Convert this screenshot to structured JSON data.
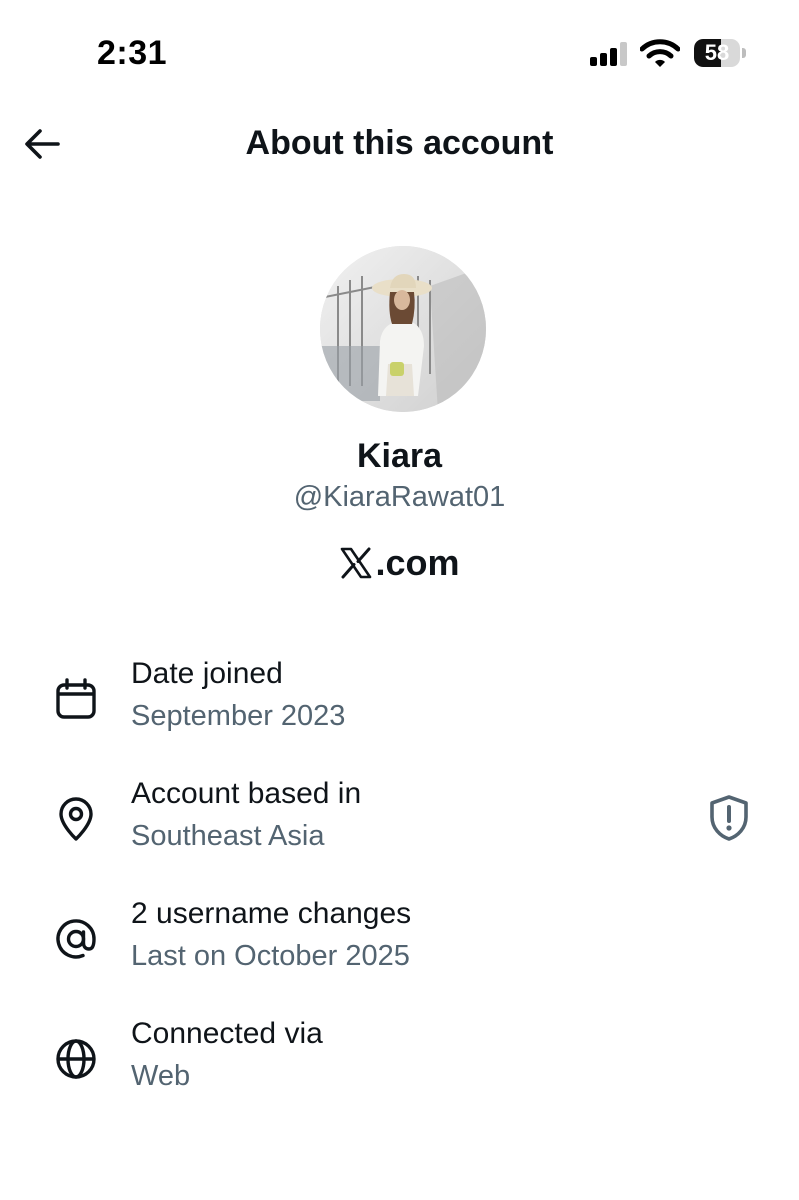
{
  "status_bar": {
    "time": "2:31",
    "battery_percent": "58",
    "battery_level": 0.58,
    "icons": [
      "signal-icon",
      "wifi-icon",
      "battery-icon"
    ]
  },
  "header": {
    "title": "About this account",
    "back_icon": "arrow-left-icon"
  },
  "profile": {
    "display_name": "Kiara",
    "username": "@KiaraRawat01",
    "brand_text": ".com",
    "brand_logo": "x-logo"
  },
  "info": {
    "date_joined": {
      "icon": "calendar-icon",
      "title": "Date joined",
      "value": "September 2023"
    },
    "account_based_in": {
      "icon": "location-pin-icon",
      "title": "Account based in",
      "value": "Southeast Asia",
      "action_icon": "shield-exclamation-icon"
    },
    "username_changes": {
      "icon": "at-sign-icon",
      "title": "2 username changes",
      "value": "Last on October 2025"
    },
    "connected_via": {
      "icon": "globe-icon",
      "title": "Connected via",
      "value": "Web"
    }
  },
  "colors": {
    "primary_text": "#0f1419",
    "secondary_text": "#536471",
    "background": "#ffffff"
  }
}
